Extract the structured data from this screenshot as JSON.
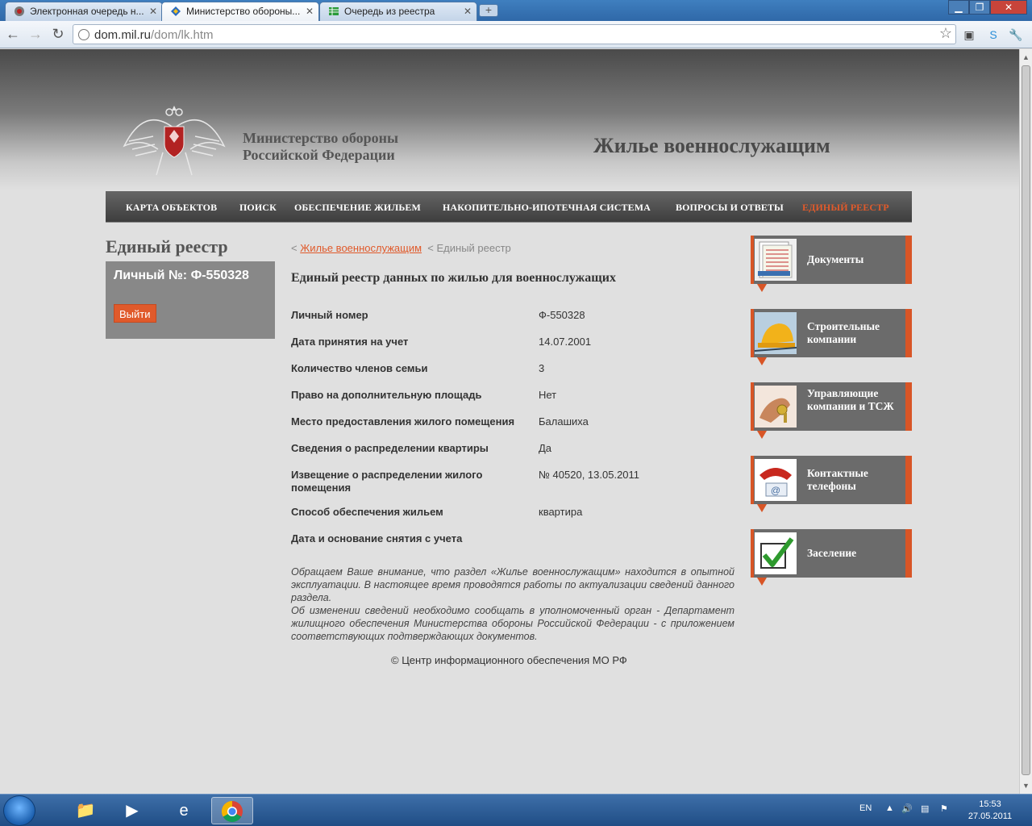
{
  "browser": {
    "tabs": [
      {
        "title": "Электронная очередь н..."
      },
      {
        "title": "Министерство обороны..."
      },
      {
        "title": "Очередь из реестра"
      }
    ],
    "url_host": "dom.mil.ru",
    "url_path": "/dom/lk.htm"
  },
  "header": {
    "ministry_line1": "Министерство обороны",
    "ministry_line2": "Российской Федерации",
    "site_title": "Жилье военнослужащим"
  },
  "menu": [
    {
      "label": "КАРТА ОБЪЕКТОВ"
    },
    {
      "label": "ПОИСК"
    },
    {
      "label": "ОБЕСПЕЧЕНИЕ ЖИЛЬЕМ"
    },
    {
      "label": "НАКОПИТЕЛЬНО-ИПОТЕЧНАЯ СИСТЕМА"
    },
    {
      "label": "ВОПРОСЫ И ОТВЕТЫ"
    },
    {
      "label": "ЕДИНЫЙ РЕЕСТР"
    }
  ],
  "sidebar": {
    "title": "Единый реестр",
    "account_number": "Личный №: Ф-550328",
    "logout_label": "Выйти"
  },
  "breadcrumb": {
    "sep": "<",
    "home": "Жилье военнослужащим",
    "current": "Единый реестр"
  },
  "main": {
    "heading": "Единый реестр данных по жилью для военнослужащих",
    "rows": [
      {
        "label": "Личный номер",
        "value": "Ф-550328"
      },
      {
        "label": "Дата принятия на учет",
        "value": "14.07.2001"
      },
      {
        "label": "Количество членов семьи",
        "value": "3"
      },
      {
        "label": "Право на дополнительную площадь",
        "value": "Нет"
      },
      {
        "label": "Место предоставления жилого помещения",
        "value": "Балашиха"
      },
      {
        "label": "Сведения о распределении квартиры",
        "value": "Да"
      },
      {
        "label": "Извещение о распределении жилого помещения",
        "value": "№ 40520, 13.05.2011"
      },
      {
        "label": "Способ обеспечения жильем",
        "value": "квартира"
      },
      {
        "label": "Дата и основание снятия с учета",
        "value": ""
      }
    ],
    "notice_1": "Обращаем Ваше внимание, что раздел «Жилье военнослужащим» находится в опытной эксплуатации. В настоящее время проводятся работы по актуализации сведений данного раздела.",
    "notice_2": "Об изменении сведений необходимо сообщать в уполномоченный орган - Департамент жилищного обеспечения Министерства обороны Российской Федерации - с приложением соответствующих подтверждающих документов.",
    "footer": "© Центр информационного обеспечения МО РФ"
  },
  "right_links": [
    {
      "label": "Документы",
      "icon": "documents-icon"
    },
    {
      "label": "Строительные компании",
      "icon": "construction-helmet-icon"
    },
    {
      "label": "Управляющие компании и ТСЖ",
      "icon": "keys-icon"
    },
    {
      "label": "Контактные телефоны",
      "icon": "phone-icon"
    },
    {
      "label": "Заселение",
      "icon": "checkmark-icon"
    }
  ],
  "taskbar": {
    "language": "EN",
    "time": "15:53",
    "date": "27.05.2011"
  },
  "colors": {
    "accent": "#e05a2b",
    "menu_bg": "#4a4a4a",
    "sidebar_box": "#888888",
    "tile_bg": "#6b6b6b"
  }
}
